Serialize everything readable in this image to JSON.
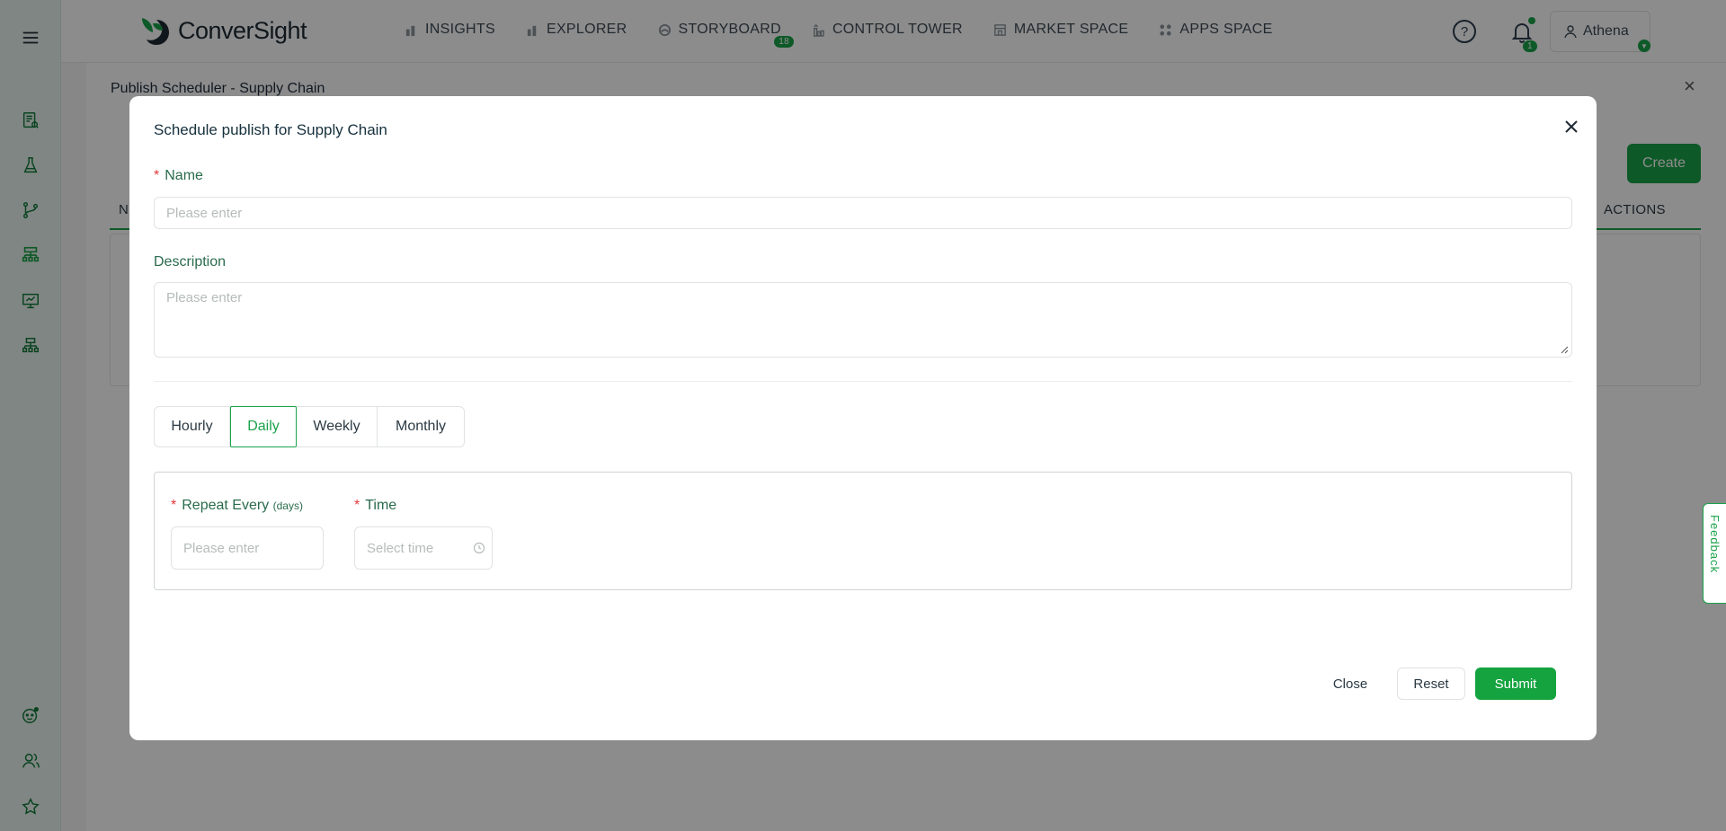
{
  "topnav": {
    "logo_text": "ConverSight",
    "items": [
      {
        "label": "INSIGHTS",
        "icon": "bar-chart-icon"
      },
      {
        "label": "EXPLORER",
        "icon": "bar-chart-icon"
      },
      {
        "label": "STORYBOARD",
        "icon": "storyboard-icon",
        "badge": "18"
      },
      {
        "label": "CONTROL TOWER",
        "icon": "control-tower-icon"
      },
      {
        "label": "MARKET SPACE",
        "icon": "market-icon"
      },
      {
        "label": "APPS SPACE",
        "icon": "apps-icon"
      }
    ],
    "notifications_badge": "1",
    "user_name": "Athena"
  },
  "sidebar": {
    "icons": [
      "menu-icon",
      "reports-icon",
      "lab-flask-icon",
      "branch-icon",
      "sitemap-icon",
      "presentation-icon",
      "org-chart-icon",
      "bot-icon",
      "users-icon",
      "star-icon"
    ]
  },
  "background": {
    "drawer_title": "Publish Scheduler - Supply Chain",
    "create_label": "Create",
    "col_first": "N",
    "col_actions": "ACTIONS",
    "feedback_label": "Feedback"
  },
  "modal": {
    "title": "Schedule publish for Supply Chain",
    "name_label": "Name",
    "name_placeholder": "Please enter",
    "description_label": "Description",
    "description_placeholder": "Please enter",
    "frequency_options": [
      "Hourly",
      "Daily",
      "Weekly",
      "Monthly"
    ],
    "frequency_selected": "Daily",
    "repeat_label": "Repeat Every",
    "repeat_hint": "(days)",
    "repeat_placeholder": "Please enter",
    "time_label": "Time",
    "time_placeholder": "Select time",
    "close_label": "Close",
    "reset_label": "Reset",
    "submit_label": "Submit"
  },
  "colors": {
    "brand_green": "#1aa34a",
    "sidebar_bg": "#eaf5ee",
    "required_red": "#e3383b"
  }
}
